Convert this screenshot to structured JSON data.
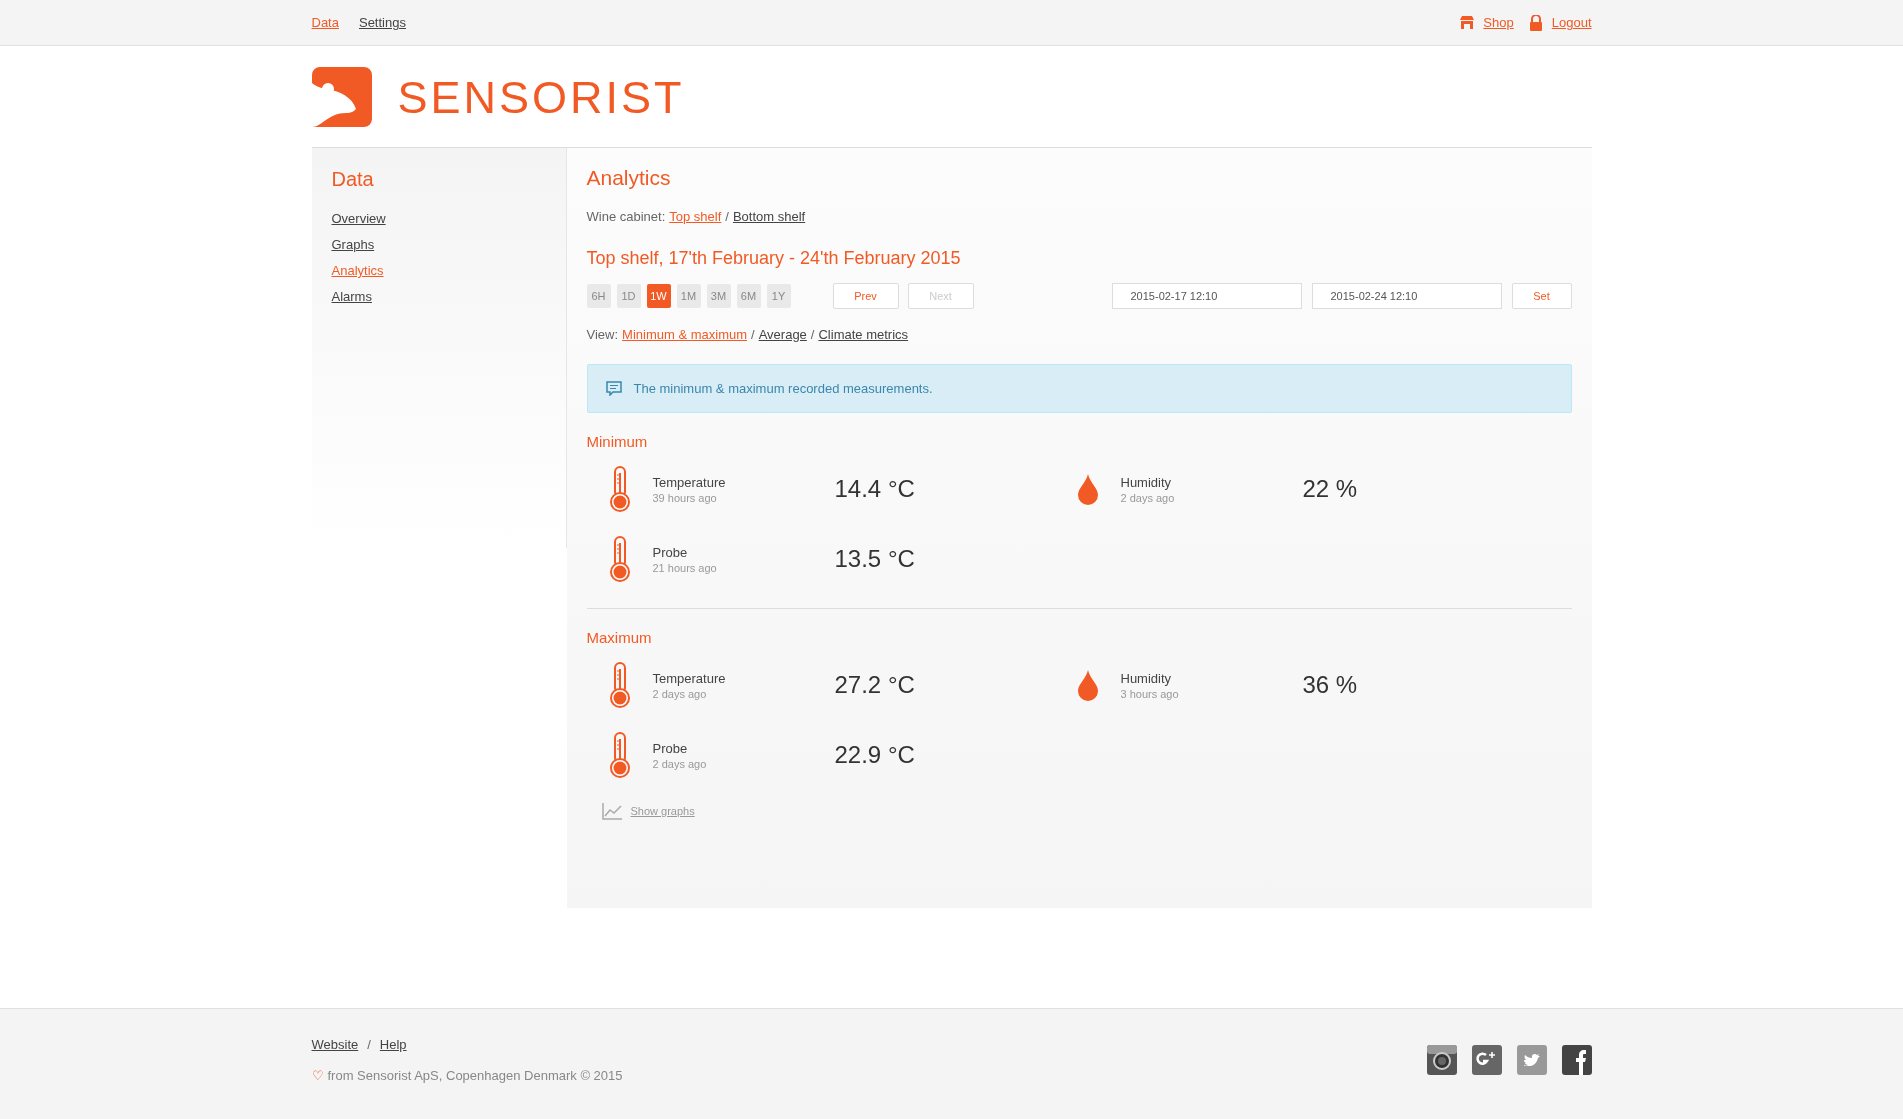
{
  "top_nav": [
    {
      "label": "Data",
      "selected": true
    },
    {
      "label": "Settings",
      "selected": false
    }
  ],
  "user_links": [
    {
      "kind": "shop",
      "label": "Shop"
    },
    {
      "kind": "lock",
      "label": "Logout"
    }
  ],
  "logo": {
    "text": "SENSORIST"
  },
  "sidebar": {
    "title": "Data",
    "items": [
      {
        "label": "Overview",
        "selected": false
      },
      {
        "label": "Graphs",
        "selected": false
      },
      {
        "label": "Analytics",
        "selected": true
      },
      {
        "label": "Alarms",
        "selected": false
      }
    ]
  },
  "main": {
    "title": "Analytics",
    "cabinet": {
      "label": "Wine cabinet:",
      "separator": "/",
      "options": [
        {
          "label": "Top shelf",
          "selected": true
        },
        {
          "label": "Bottom shelf",
          "selected": false
        }
      ]
    },
    "period_title": "Top shelf, 17'th February - 24'th February 2015",
    "ranges": [
      {
        "label": "6H",
        "selected": false
      },
      {
        "label": "1D",
        "selected": false
      },
      {
        "label": "1W",
        "selected": true
      },
      {
        "label": "1M",
        "selected": false
      },
      {
        "label": "3M",
        "selected": false
      },
      {
        "label": "6M",
        "selected": false
      },
      {
        "label": "1Y",
        "selected": false
      }
    ],
    "pager": [
      {
        "label": "Prev",
        "disabled": false
      },
      {
        "label": "Next",
        "disabled": true
      }
    ],
    "date_from": {
      "value": "2015-02-17 12:10"
    },
    "date_to": {
      "value": "2015-02-24 12:10"
    },
    "set_button": "Set",
    "view": {
      "label": "View:",
      "separator": "/",
      "options": [
        {
          "label": "Minimum & maximum",
          "selected": true
        },
        {
          "label": "Average",
          "selected": false
        },
        {
          "label": "Climate metrics",
          "selected": false
        }
      ]
    },
    "info": "The minimum & maximum recorded measurements.",
    "sections": [
      {
        "title": "Minimum",
        "readings": [
          {
            "kind": "temperature",
            "name": "Temperature",
            "time": "39 hours ago",
            "value": "14.4 °C"
          },
          {
            "kind": "humidity",
            "name": "Humidity",
            "time": "2 days ago",
            "value": "22 %"
          },
          {
            "kind": "temperature",
            "name": "Probe",
            "time": "21 hours ago",
            "value": "13.5 °C"
          }
        ]
      },
      {
        "title": "Maximum",
        "readings": [
          {
            "kind": "temperature",
            "name": "Temperature",
            "time": "2 days ago",
            "value": "27.2 °C"
          },
          {
            "kind": "humidity",
            "name": "Humidity",
            "time": "3 hours ago",
            "value": "36 %"
          },
          {
            "kind": "temperature",
            "name": "Probe",
            "time": "2 days ago",
            "value": "22.9 °C"
          }
        ]
      }
    ],
    "show_graphs": "Show graphs"
  },
  "footer": {
    "separator": "/",
    "links": [
      "Website",
      "Help"
    ],
    "heart": "♡",
    "copyright": "from Sensorist ApS, Copenhagen Denmark © 2015",
    "social": [
      {
        "kind": "instagram"
      },
      {
        "kind": "googleplus"
      },
      {
        "kind": "twitter"
      },
      {
        "kind": "facebook"
      }
    ]
  }
}
